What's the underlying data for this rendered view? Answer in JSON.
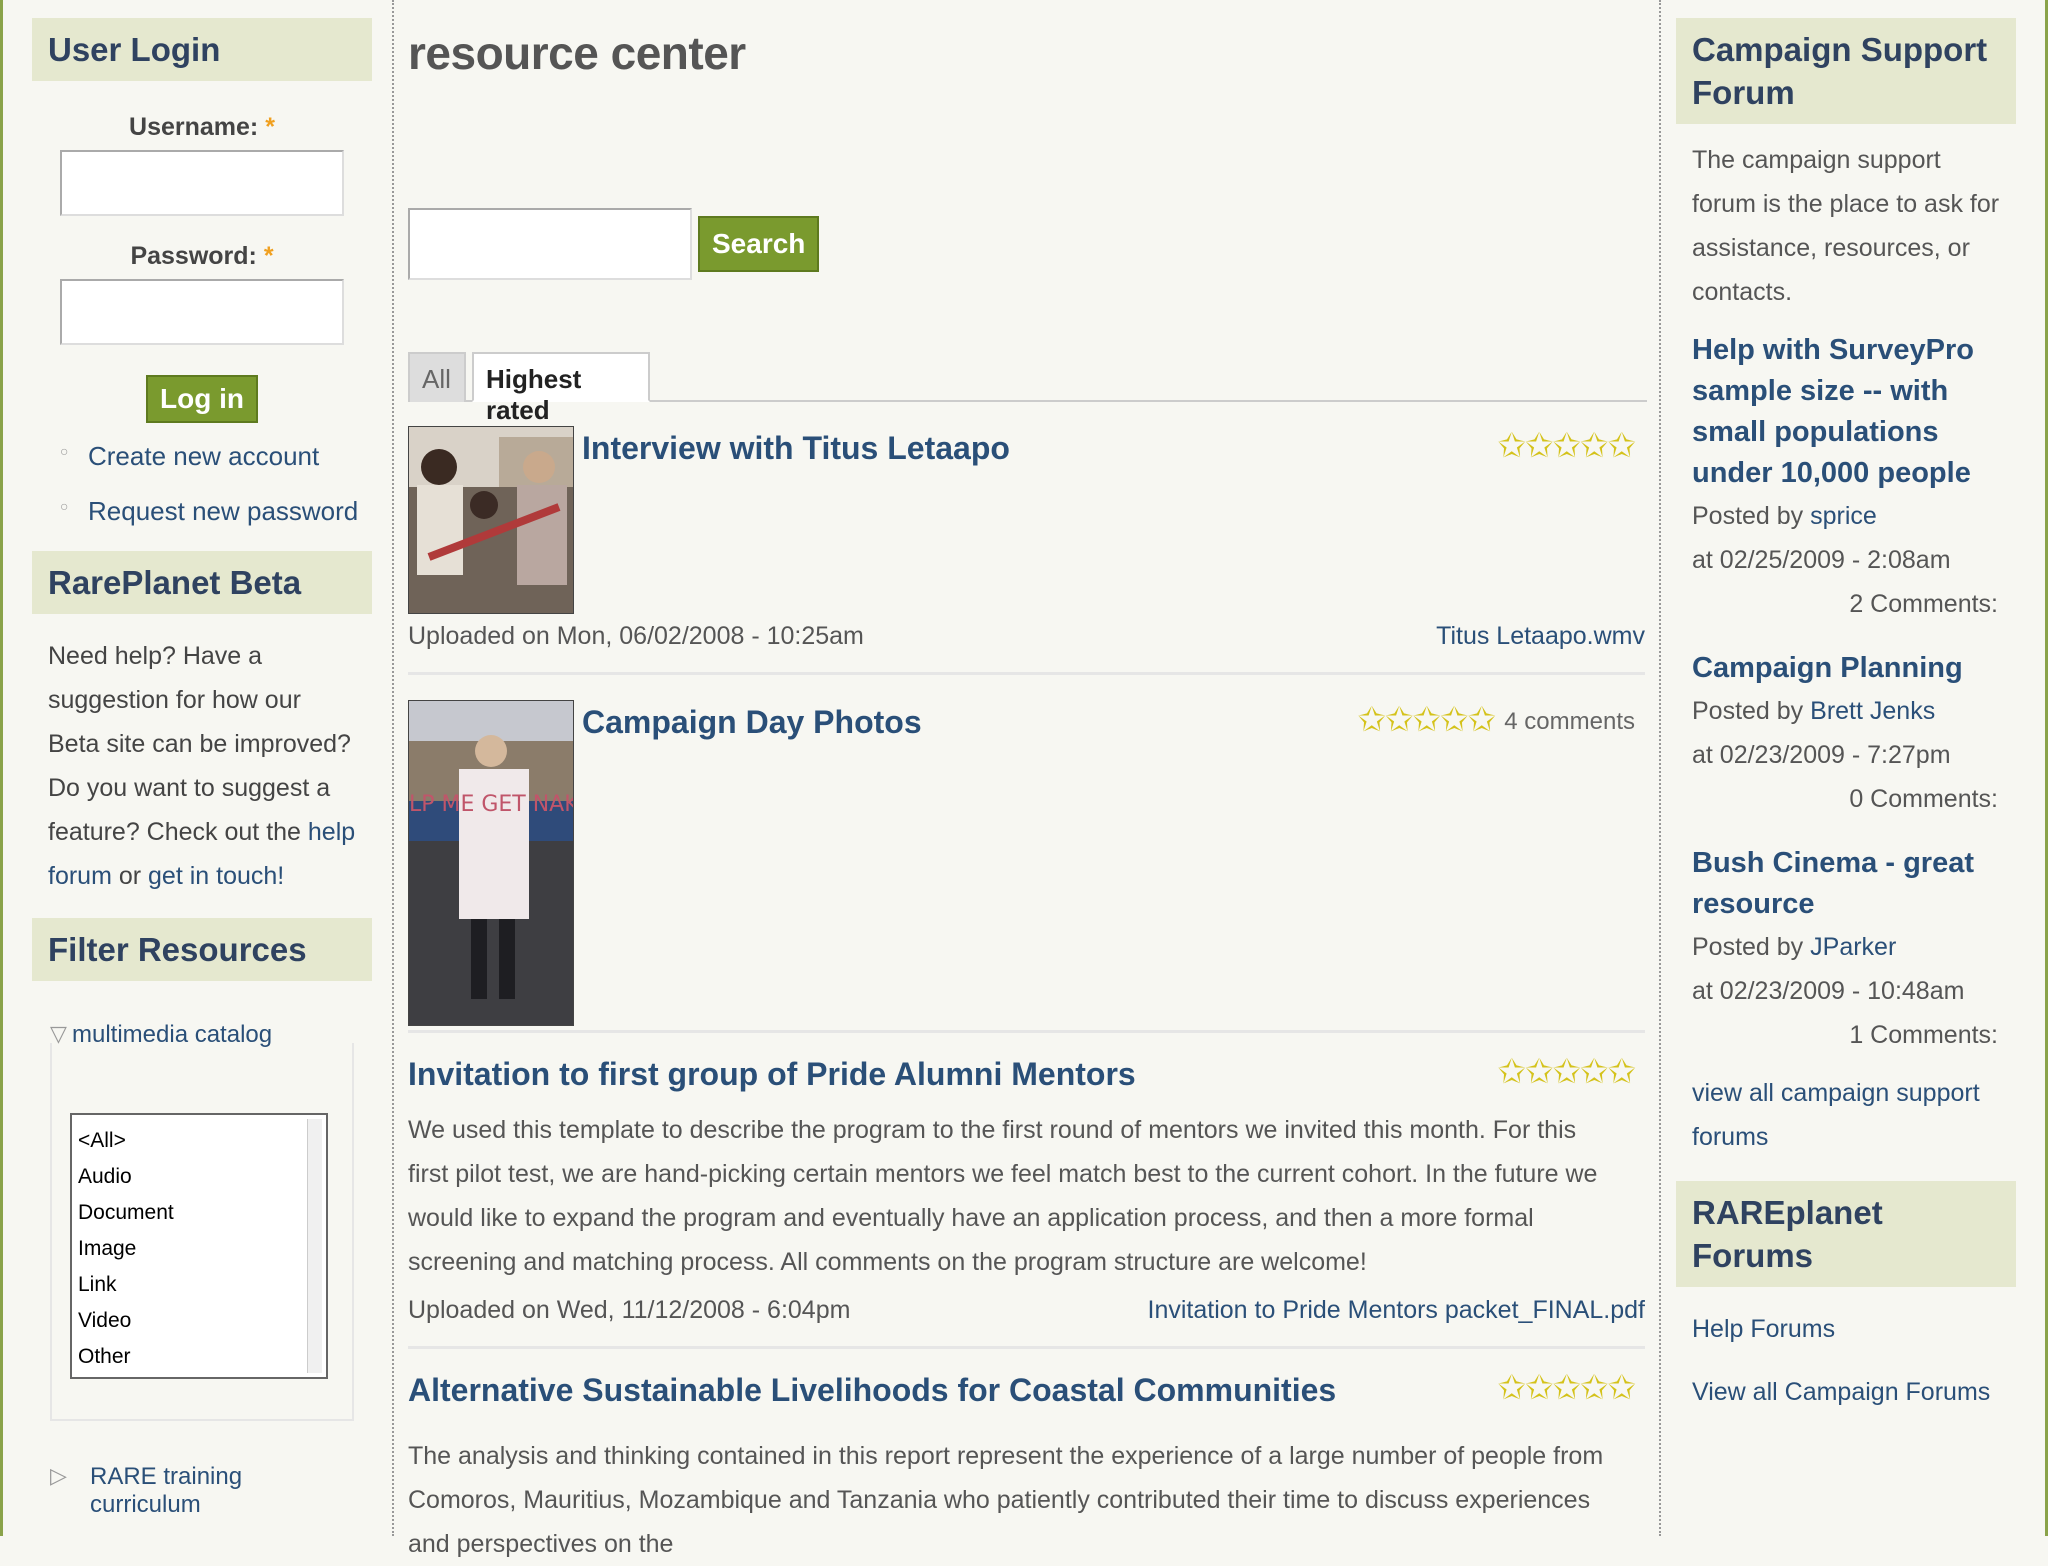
{
  "user_login": {
    "title": "User Login",
    "username_label": "Username:",
    "password_label": "Password:",
    "required_mark": "*",
    "login_button": "Log in",
    "links": [
      "Create new account",
      "Request new password"
    ]
  },
  "rareplanet_beta": {
    "title": "RarePlanet Beta",
    "text_before": "Need help? Have a suggestion for how our Beta site can be improved? Do you want to suggest a feature? Check out the ",
    "help_forum_link": "help forum",
    "text_middle": " or ",
    "get_in_touch_link": "get in touch!"
  },
  "filter": {
    "title": "Filter Resources",
    "multimedia_legend": "multimedia catalog",
    "options": [
      "<All>",
      "Audio",
      "Document",
      "Image",
      "Link",
      "Video",
      "Other"
    ],
    "training_legend": "RARE training curriculum"
  },
  "main": {
    "heading": "resource center",
    "search_button": "Search",
    "tabs": {
      "all": "All",
      "highest_rated": "Highest rated"
    },
    "items": [
      {
        "title": "Interview with Titus Letaapo",
        "stars": "✩✩✩✩✩",
        "rating": 5,
        "meta": "Uploaded on Mon, 06/02/2008 - 10:25am",
        "file": "Titus Letaapo.wmv"
      },
      {
        "title": "Campaign Day Photos",
        "stars": "✩✩✩✩✩",
        "rating": 5,
        "comments": "4 comments",
        "sign_text": "HELP ME GET NAKED"
      },
      {
        "title": "Invitation to first group of Pride Alumni Mentors",
        "stars": "✩✩✩✩✩",
        "rating": 5,
        "desc": "We used this template to describe the program to the first round of mentors we invited this month. For this first pilot test, we are hand-picking certain mentors we feel match best to the current cohort. In the future we would like to expand the program and eventually have an application process, and then a more formal screening and matching process. All comments on the program structure are welcome!",
        "meta": "Uploaded on Wed, 11/12/2008 - 6:04pm",
        "file": "Invitation to Pride Mentors packet_FINAL.pdf"
      },
      {
        "title": "Alternative Sustainable Livelihoods for Coastal Communities",
        "stars": "✩✩✩✩✩",
        "rating": 5,
        "desc": "The analysis and thinking contained in this report represent the experience of a large number of people from Comoros, Mauritius, Mozambique and Tanzania who patiently contributed their time to discuss experiences and perspectives on the"
      }
    ]
  },
  "campaign_forum": {
    "title": "Campaign Support Forum",
    "description": "The campaign support forum is the place to ask for assistance, resources, or contacts.",
    "posted_by_label": "Posted by",
    "posts": [
      {
        "title": "Help with SurveyPro sample size -- with small populations under 10,000 people",
        "author": "sprice",
        "date": "at 02/25/2009 - 2:08am",
        "comments": "2 Comments:"
      },
      {
        "title": "Campaign Planning",
        "author": "Brett Jenks",
        "date": "at 02/23/2009 - 7:27pm",
        "comments": "0 Comments:"
      },
      {
        "title": "Bush Cinema - great resource",
        "author": "JParker",
        "date": "at 02/23/2009 - 10:48am",
        "comments": "1 Comments:"
      }
    ],
    "view_all": "view all campaign support forums"
  },
  "rareplanet_forums": {
    "title": "RAREplanet Forums",
    "links": [
      "Help Forums",
      "View all Campaign Forums"
    ]
  },
  "colors": {
    "accent_green": "#7a9a2e",
    "block_header_bg": "#e5e8cf",
    "link_blue": "#2a4f78",
    "star_yellow": "#d4c21a"
  }
}
